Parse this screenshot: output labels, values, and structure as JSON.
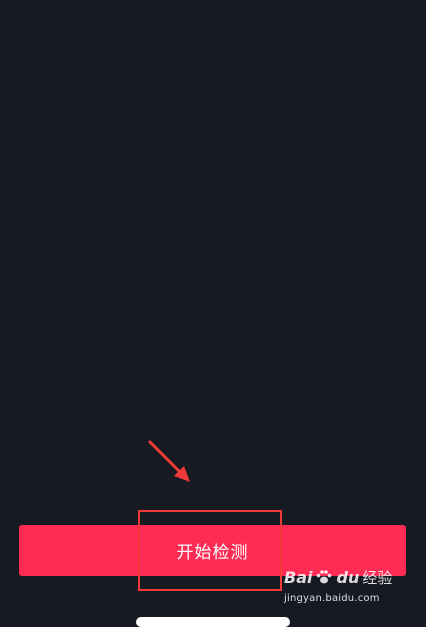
{
  "start_button": {
    "label": "开始检测"
  },
  "colors": {
    "background": "#171923",
    "button": "#fe2c55",
    "annotation": "#f23a3a"
  },
  "annotation": {
    "arrow_icon": "arrow-down-right-icon",
    "box": "highlight-box"
  },
  "watermark": {
    "brand": "Bai",
    "brand2": "du",
    "suffix": "经验",
    "url": "jingyan.baidu.com"
  }
}
